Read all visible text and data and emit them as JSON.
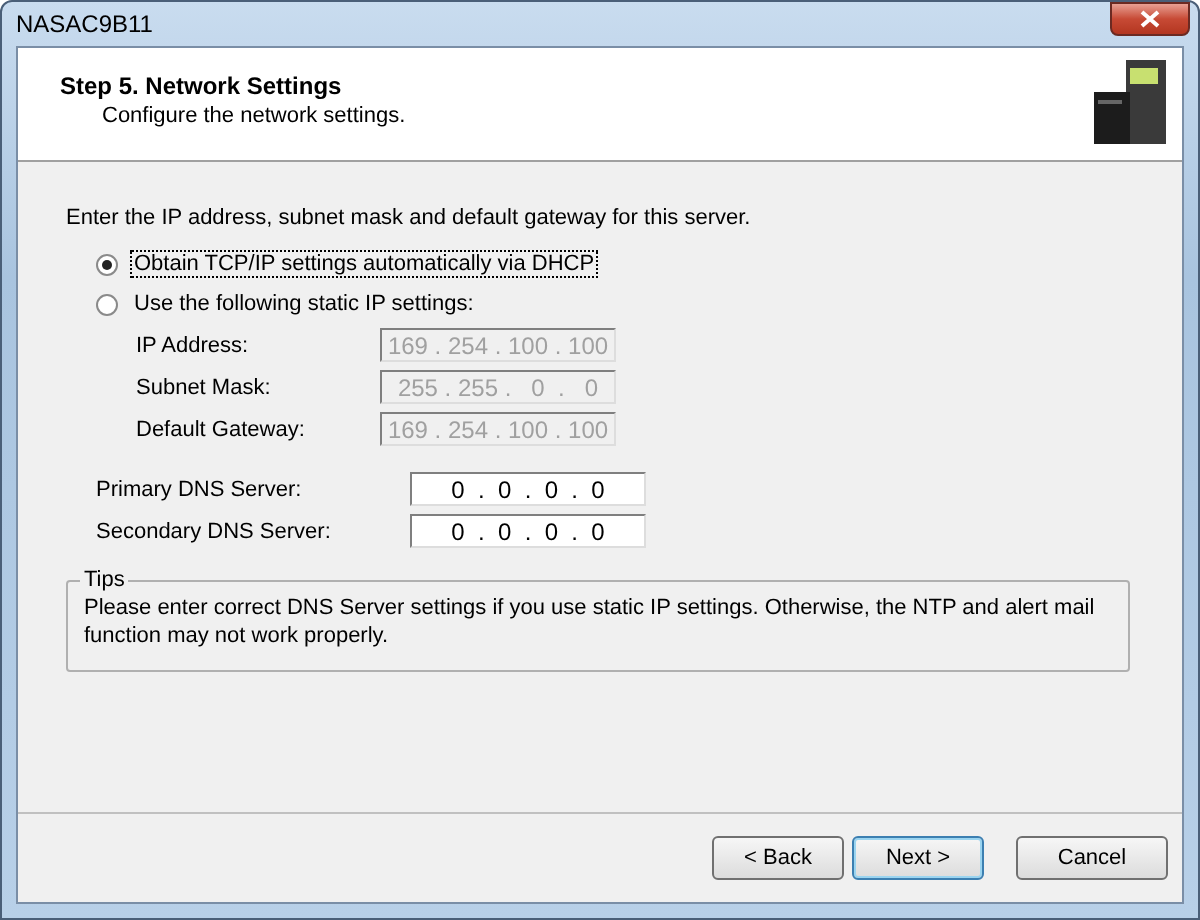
{
  "window": {
    "title": "NASAC9B11"
  },
  "header": {
    "title": "Step 5. Network Settings",
    "subtitle": "Configure the network settings."
  },
  "instruction": "Enter the IP address, subnet mask and default gateway for this server.",
  "options": [
    {
      "label": "Obtain TCP/IP settings automatically via DHCP",
      "selected": true,
      "focused": true
    },
    {
      "label": "Use the following static IP settings:",
      "selected": false,
      "focused": false
    }
  ],
  "static_fields": [
    {
      "label": "IP Address:",
      "disabled": true,
      "value": "169 . 254 . 100 . 100"
    },
    {
      "label": "Subnet Mask:",
      "disabled": true,
      "value": "255 . 255 .   0  .   0"
    },
    {
      "label": "Default Gateway:",
      "disabled": true,
      "value": "169 . 254 . 100 . 100"
    }
  ],
  "dns_fields": [
    {
      "label": "Primary DNS Server:",
      "disabled": false,
      "value": "0  .  0  .  0  .  0"
    },
    {
      "label": "Secondary DNS Server:",
      "disabled": false,
      "value": "0  .  0  .  0  .  0"
    }
  ],
  "tips": {
    "title": "Tips",
    "text": "Please enter correct DNS Server settings if you use static IP settings.  Otherwise, the NTP and alert mail function may not work properly."
  },
  "buttons": [
    {
      "label": "< Back",
      "default": false
    },
    {
      "label": "Next >",
      "default": true
    },
    {
      "label": "Cancel",
      "default": false
    }
  ]
}
